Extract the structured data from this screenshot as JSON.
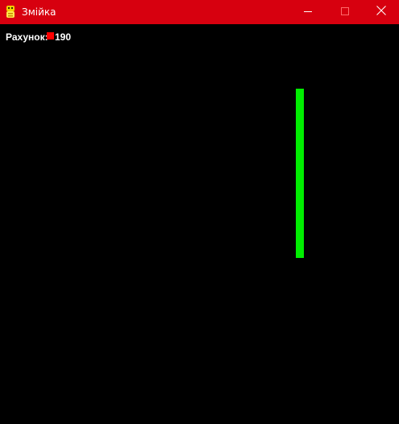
{
  "window": {
    "title": "Змійка",
    "accent_color": "#d7000f",
    "icon": "python-snake-icon",
    "controls": [
      "minimize-icon",
      "maximize-icon",
      "close-icon"
    ]
  },
  "game": {
    "background": "#000000",
    "score_label": "Рахунок:",
    "score_value": "190",
    "food_color": "#ff0000",
    "snake_color": "#00ee00",
    "snake_length": 21
  }
}
